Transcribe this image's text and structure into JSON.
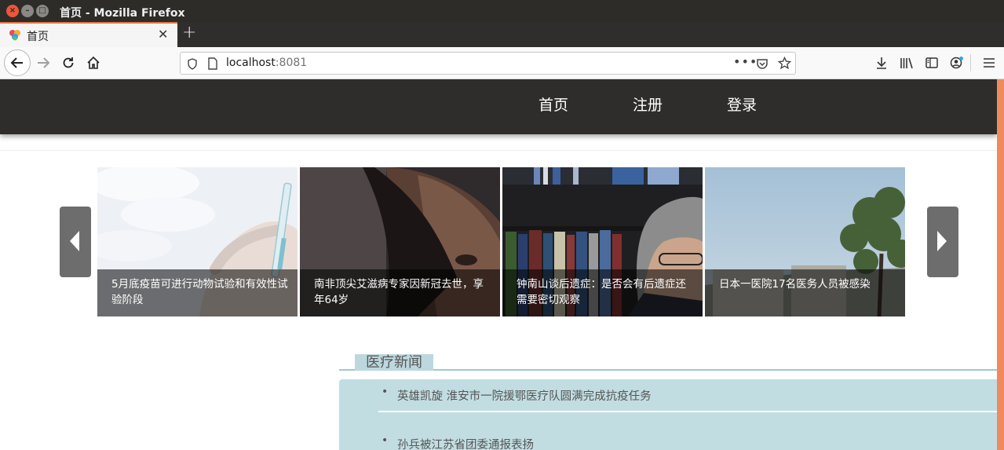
{
  "window": {
    "title": "首页 - Mozilla Firefox"
  },
  "tab": {
    "label": "首页"
  },
  "url": {
    "host": "localhost",
    "port": ":8081"
  },
  "site_nav": {
    "home": "首页",
    "register": "注册",
    "login": "登录"
  },
  "carousel": {
    "slides": [
      {
        "caption": "5月底疫苗可进行动物试验和有效性试验阶段"
      },
      {
        "caption": "南非顶尖艾滋病专家因新冠去世，享年64岁"
      },
      {
        "caption": "钟南山谈后遗症：是否会有后遗症还需要密切观察"
      },
      {
        "caption": "日本一医院17名医务人员被感染"
      }
    ]
  },
  "news": {
    "section_title": "医疗新闻",
    "items": [
      {
        "bullet": "•",
        "title": "英雄凯旋 淮安市一院援鄂医疗队圆满完成抗疫任务"
      },
      {
        "bullet": "•",
        "title": "孙兵被江苏省团委通报表扬"
      }
    ]
  },
  "colors": {
    "accent": "#e8743b",
    "nav_bg": "#2e2d2b",
    "news_bg": "#c2dde2",
    "news_line": "#9fc9cb"
  },
  "icons": {
    "back": "arrow-left-icon",
    "forward": "arrow-right-icon",
    "reload": "reload-icon",
    "home": "home-icon",
    "site_info": "shield-icon",
    "page": "page-icon",
    "more": "ellipsis-icon",
    "pocket": "pocket-icon",
    "bookmark": "star-icon",
    "downloads": "download-icon",
    "library": "library-icon",
    "sidebar": "sidebar-icon",
    "account": "account-icon",
    "menu": "hamburger-menu-icon"
  }
}
